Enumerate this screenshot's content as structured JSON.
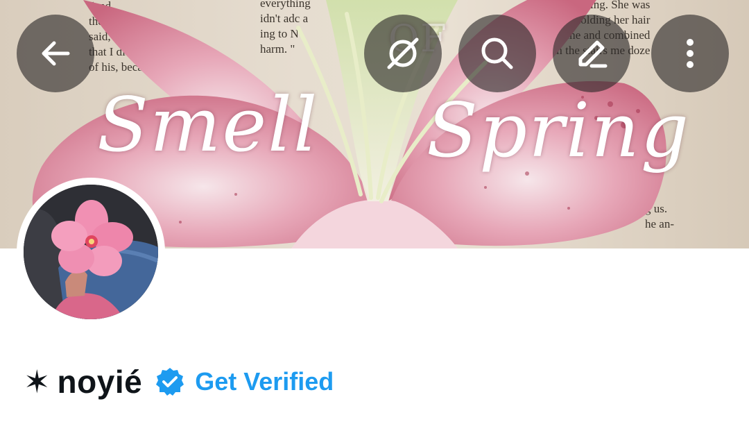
{
  "header": {
    "banner": {
      "title_word_1": "Smell",
      "title_word_2": "Spring",
      "title_small": "OF",
      "book_text_left": "“and\nthe m\nsaid, “She\nthat I didn't\nof his, because",
      "book_text_mid": "everything\nidn't adc a\ning to N\nharm. \"",
      "book_text_right": "her coming. She was\nwater and holding her hair\nnext to me and combined\nd from the stairs me doze",
      "book_text_far": "I\n\ng us.\nhe an-"
    },
    "buttons": {
      "back_icon": "arrow-left-icon",
      "grok_icon": "grok-icon",
      "search_icon": "search-icon",
      "edit_icon": "pencil-icon",
      "more_icon": "more-vertical-icon"
    }
  },
  "profile": {
    "name_prefix": "✶",
    "display_name": "noyié",
    "verified_badge": "verified-badge-icon",
    "get_verified_label": "Get Verified"
  },
  "colors": {
    "accent": "#1d9bf0",
    "text": "#0f1419",
    "button_overlay": "rgba(44,40,40,0.62)"
  }
}
